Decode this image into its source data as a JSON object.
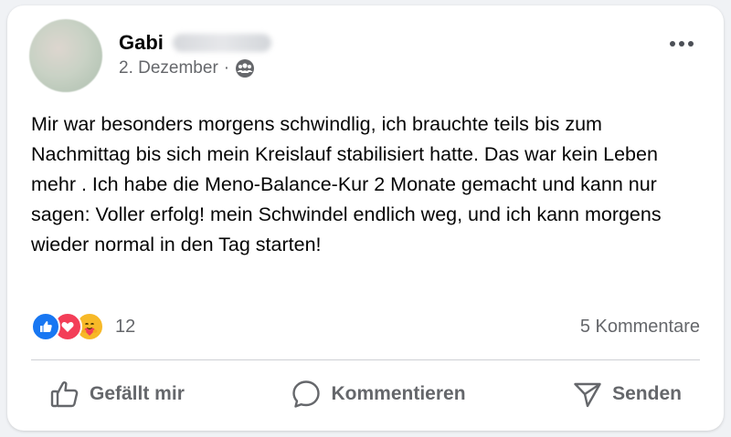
{
  "post": {
    "author_first_name": "Gabi",
    "date": "2. Dezember",
    "separator": "·",
    "audience_icon": "group-audience-icon",
    "more_icon": "more-options-icon",
    "text": "Mir war besonders morgens schwindlig, ich brauchte teils bis zum Nachmittag bis sich mein Kreislauf stabilisiert hatte. Das war kein Leben mehr . Ich habe die Meno-Balance-Kur 2 Monate gemacht und kann nur sagen: Voller erfolg! mein Schwindel endlich weg, und ich kann morgens wieder normal in den Tag starten!"
  },
  "reactions": {
    "types": [
      "like",
      "love",
      "care"
    ],
    "count": "12",
    "comments": "5 Kommentare"
  },
  "actions": [
    {
      "label": "Gefällt mir",
      "icon": "thumbs-up-icon"
    },
    {
      "label": "Kommentieren",
      "icon": "comment-bubble-icon"
    },
    {
      "label": "Senden",
      "icon": "send-icon"
    }
  ],
  "colors": {
    "like_blue": "#1877f2",
    "love_red": "#f33e58",
    "care_yellow": "#f7b928",
    "secondary_text": "#65676b"
  }
}
